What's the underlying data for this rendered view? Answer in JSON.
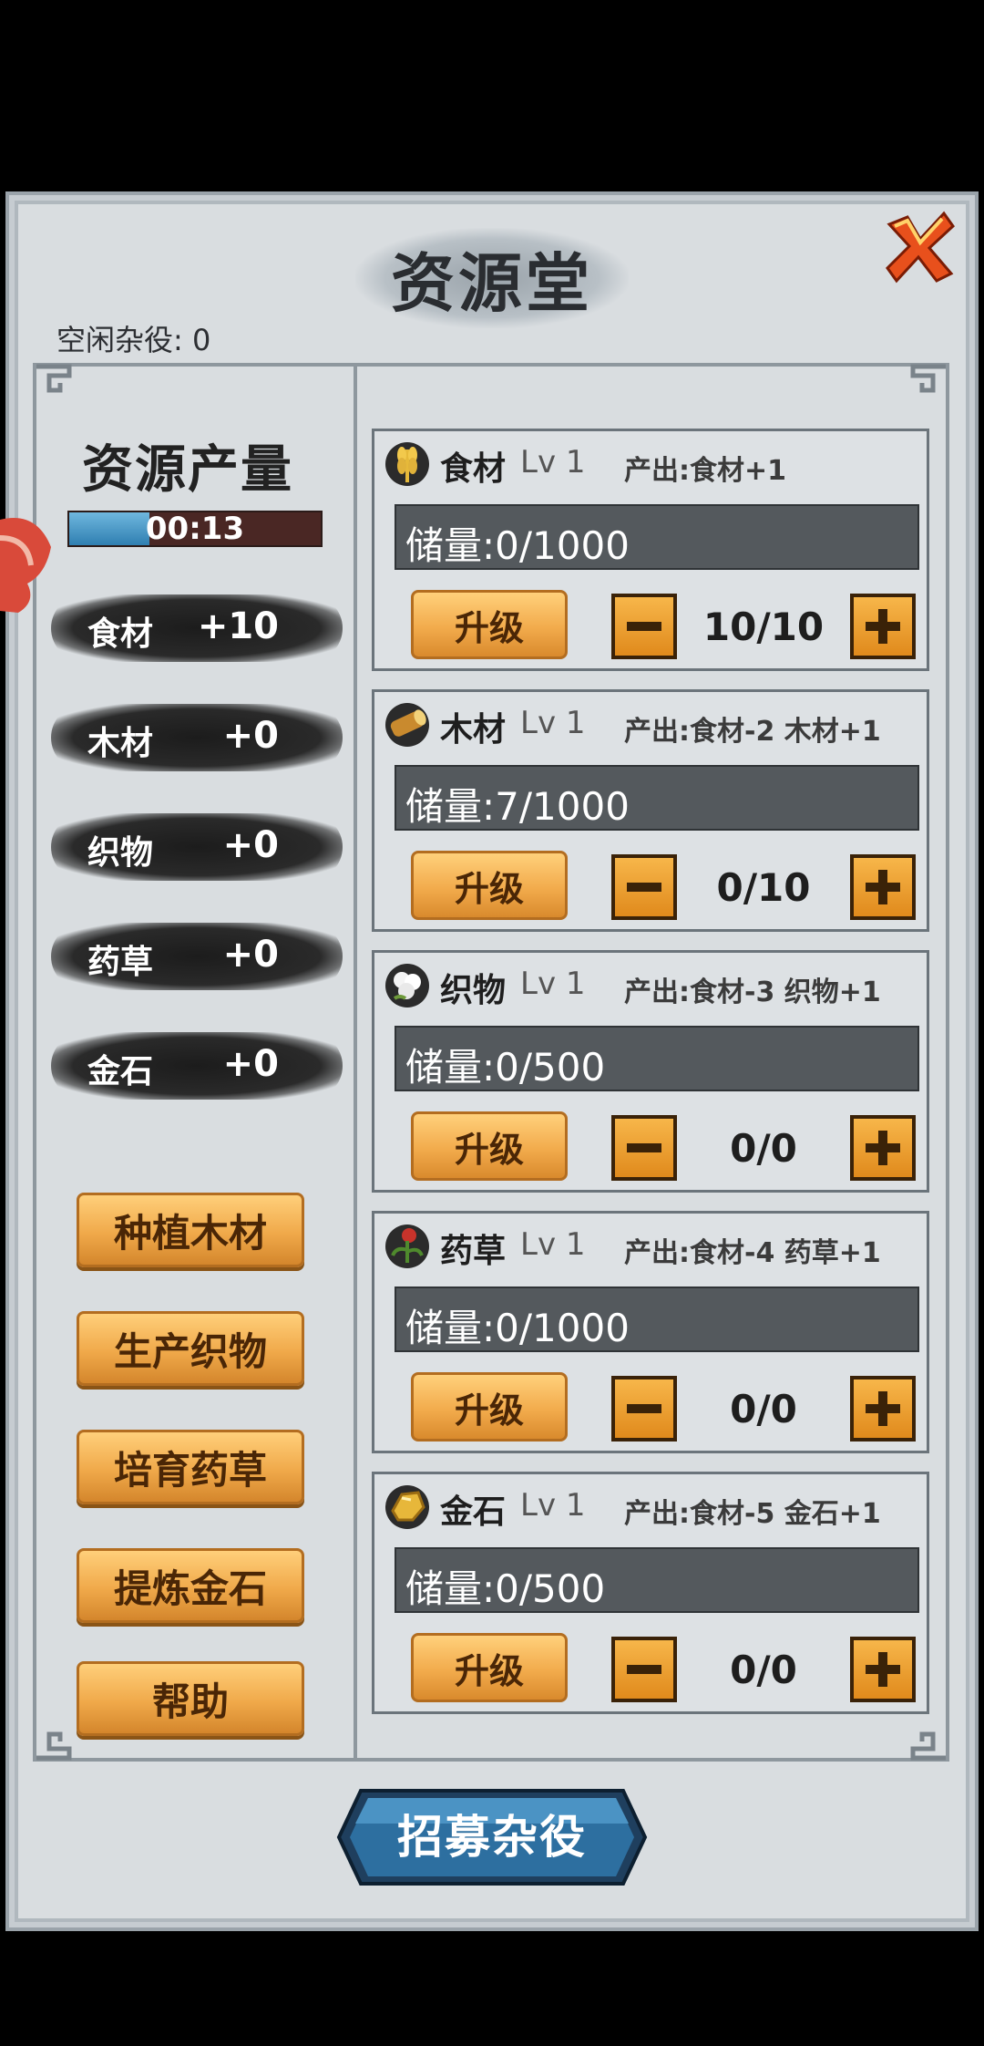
{
  "title": "资源堂",
  "idle_workers": "空闲杂役: 0",
  "production": {
    "title": "资源产量",
    "timer": "00:13",
    "timer_progress": 0.32,
    "rows": [
      {
        "name": "食材",
        "value": "+10"
      },
      {
        "name": "木材",
        "value": "+0"
      },
      {
        "name": "织物",
        "value": "+0"
      },
      {
        "name": "药草",
        "value": "+0"
      },
      {
        "name": "金石",
        "value": "+0"
      }
    ]
  },
  "actions": [
    "种植木材",
    "生产织物",
    "培育药草",
    "提炼金石",
    "帮助"
  ],
  "cards": [
    {
      "name": "食材",
      "level": "Lv 1",
      "output": "产出:食材+1",
      "storage": "储量:0/1000",
      "upgrade": "升级",
      "count": "10/10",
      "icon": "wheat-icon"
    },
    {
      "name": "木材",
      "level": "Lv 1",
      "output": "产出:食材-2  木材+1",
      "storage": "储量:7/1000",
      "upgrade": "升级",
      "count": "0/10",
      "icon": "log-icon"
    },
    {
      "name": "织物",
      "level": "Lv 1",
      "output": "产出:食材-3  织物+1",
      "storage": "储量:0/500",
      "upgrade": "升级",
      "count": "0/0",
      "icon": "cotton-icon"
    },
    {
      "name": "药草",
      "level": "Lv 1",
      "output": "产出:食材-4  药草+1",
      "storage": "储量:0/1000",
      "upgrade": "升级",
      "count": "0/0",
      "icon": "herb-icon"
    },
    {
      "name": "金石",
      "level": "Lv 1",
      "output": "产出:食材-5  金石+1",
      "storage": "储量:0/500",
      "upgrade": "升级",
      "count": "0/0",
      "icon": "gold-ore-icon"
    }
  ],
  "recruit_label": "招募杂役",
  "colors": {
    "accent_orange": "#f0a94a",
    "panel": "#d9dde0",
    "ink": "#1c1c1c",
    "recruit_blue": "#2d6fa0"
  }
}
